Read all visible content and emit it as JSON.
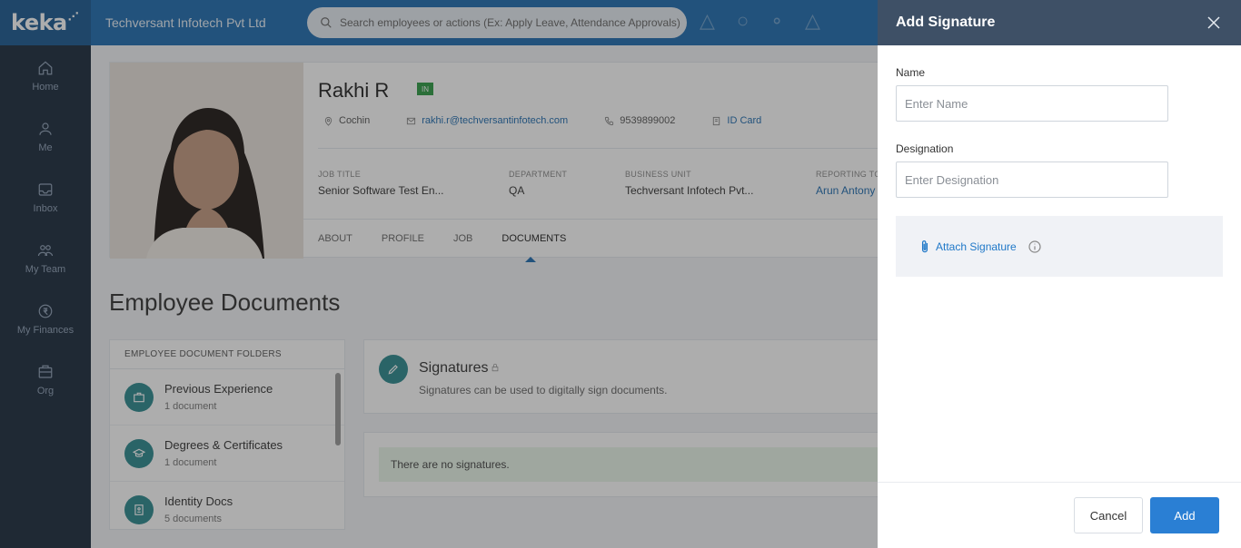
{
  "sidebar": {
    "logo": "keka",
    "items": [
      {
        "label": "Home",
        "icon": "home-icon"
      },
      {
        "label": "Me",
        "icon": "user-icon"
      },
      {
        "label": "Inbox",
        "icon": "inbox-icon"
      },
      {
        "label": "My Team",
        "icon": "team-icon"
      },
      {
        "label": "My Finances",
        "icon": "finances-icon"
      },
      {
        "label": "Org",
        "icon": "org-icon"
      }
    ]
  },
  "topbar": {
    "company": "Techversant Infotech Pvt Ltd",
    "search_placeholder": "Search employees or actions (Ex: Apply Leave, Attendance Approvals)"
  },
  "profile": {
    "name": "Rakhi R",
    "country_badge": "IN",
    "location": "Cochin",
    "email": "rakhi.r@techversantinfotech.com",
    "phone": "9539899002",
    "id_card": "ID Card",
    "fields": [
      {
        "label": "JOB TITLE",
        "value": "Senior Software Test En..."
      },
      {
        "label": "DEPARTMENT",
        "value": "QA"
      },
      {
        "label": "BUSINESS UNIT",
        "value": "Techversant Infotech Pvt..."
      },
      {
        "label": "REPORTING TO",
        "value": "Arun Antony"
      }
    ],
    "tabs": [
      "ABOUT",
      "PROFILE",
      "JOB",
      "DOCUMENTS"
    ],
    "active_tab": "DOCUMENTS"
  },
  "documents": {
    "heading": "Employee Documents",
    "folders_header": "EMPLOYEE DOCUMENT FOLDERS",
    "folders": [
      {
        "name": "Previous Experience",
        "count": "1 document"
      },
      {
        "name": "Degrees & Certificates",
        "count": "1 document"
      },
      {
        "name": "Identity Docs",
        "count": "5 documents"
      }
    ],
    "signatures_title": "Signatures",
    "signatures_desc": "Signatures can be used to digitally sign documents.",
    "empty_message": "There are no signatures."
  },
  "drawer": {
    "title": "Add Signature",
    "name_label": "Name",
    "name_placeholder": "Enter Name",
    "designation_label": "Designation",
    "designation_placeholder": "Enter Designation",
    "attach_label": "Attach Signature",
    "cancel_label": "Cancel",
    "add_label": "Add"
  },
  "colors": {
    "brand": "#1f6cb0",
    "sidebar": "#1b2a3d",
    "drawer_header": "#3e5066",
    "primary_button": "#2a7fd4",
    "accent_teal": "#2d8a8f"
  }
}
